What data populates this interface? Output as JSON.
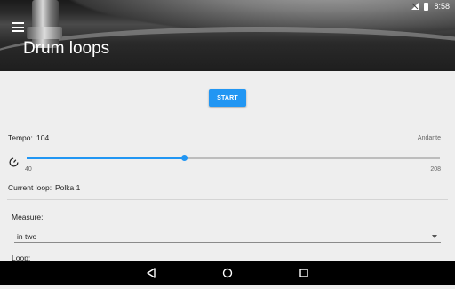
{
  "status_bar": {
    "time": "8:58"
  },
  "app_bar": {
    "title": "Drum loops",
    "menu_icon": "hamburger-icon"
  },
  "controls": {
    "start_label": "START"
  },
  "tempo": {
    "label": "Tempo:",
    "value": "104",
    "marking": "Andante",
    "min_label": "40",
    "max_label": "208",
    "slider_fraction": 0.381
  },
  "current_loop": {
    "label": "Current loop:",
    "value": "Polka 1"
  },
  "measure": {
    "label": "Measure:",
    "selected": "in two"
  },
  "loop": {
    "label": "Loop:"
  },
  "colors": {
    "accent": "#2196f3",
    "background": "#eeeeee",
    "navbar": "#000000"
  },
  "navbar": {
    "back_icon": "back-icon",
    "home_icon": "home-icon",
    "recents_icon": "recents-icon"
  }
}
